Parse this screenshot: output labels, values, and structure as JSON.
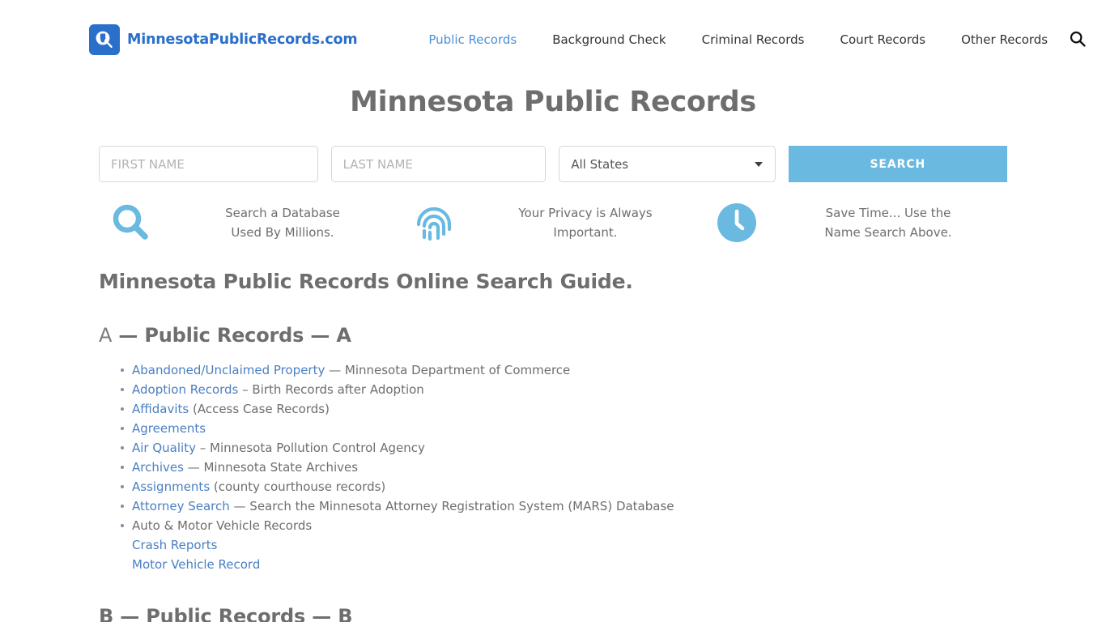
{
  "header": {
    "brand_name": "MinnesotaPublicRecords.com",
    "logo_icon": "magnifier-minnesota-icon",
    "search_icon": "search-icon",
    "nav": [
      {
        "label": "Public Records",
        "active": true
      },
      {
        "label": "Background Check",
        "active": false
      },
      {
        "label": "Criminal Records",
        "active": false
      },
      {
        "label": "Court Records",
        "active": false
      },
      {
        "label": "Other Records",
        "active": false
      }
    ]
  },
  "hero": {
    "title": "Minnesota Public Records"
  },
  "search_form": {
    "first_name_placeholder": "FIRST NAME",
    "first_name_value": "",
    "last_name_placeholder": "LAST NAME",
    "last_name_value": "",
    "state_selected": "All States",
    "state_options": [
      "All States"
    ],
    "submit_label": "SEARCH",
    "submit_color": "#6ab9e0"
  },
  "features": [
    {
      "icon": "search-icon",
      "line1": "Search a Database",
      "line2": "Used By Millions."
    },
    {
      "icon": "fingerprint-icon",
      "line1": "Your Privacy is Always",
      "line2": "Important."
    },
    {
      "icon": "clock-icon",
      "line1": "Save Time... Use the",
      "line2": "Name Search Above."
    }
  ],
  "content": {
    "guide_title": "Minnesota Public Records Online Search Guide.",
    "section_a": {
      "letter": "A",
      "middle": " — Public Records — ",
      "letter_end": "A"
    },
    "section_b": {
      "letter": "B",
      "middle": " — Public Records — ",
      "letter_end": "B"
    },
    "list_a": [
      {
        "link": "Abandoned/Unclaimed Property",
        "tail": " — Minnesota Department of Commerce"
      },
      {
        "link": "Adoption Records",
        "tail": " – Birth Records after Adoption"
      },
      {
        "link": "Affidavits",
        "tail": " (Access Case Records)"
      },
      {
        "link": "Agreements",
        "tail": ""
      },
      {
        "link": "Air Quality",
        "tail": " – Minnesota Pollution Control Agency"
      },
      {
        "link": "Archives",
        "tail": " — Minnesota State Archives"
      },
      {
        "link": "Assignments",
        "tail": " (county courthouse records)"
      },
      {
        "link": "Attorney Search",
        "tail": " — Search the Minnesota Attorney Registration System (MARS) Database"
      }
    ],
    "auto_item": {
      "text": "Auto & Motor Vehicle Records",
      "sub_links": [
        "Crash Reports",
        "Motor Vehicle Record"
      ]
    }
  },
  "colors": {
    "brand_blue": "#2a6fc9",
    "link_blue": "#4a7fc1",
    "accent_light_blue": "#6ab9e0",
    "text_gray": "#6e6e6e"
  }
}
